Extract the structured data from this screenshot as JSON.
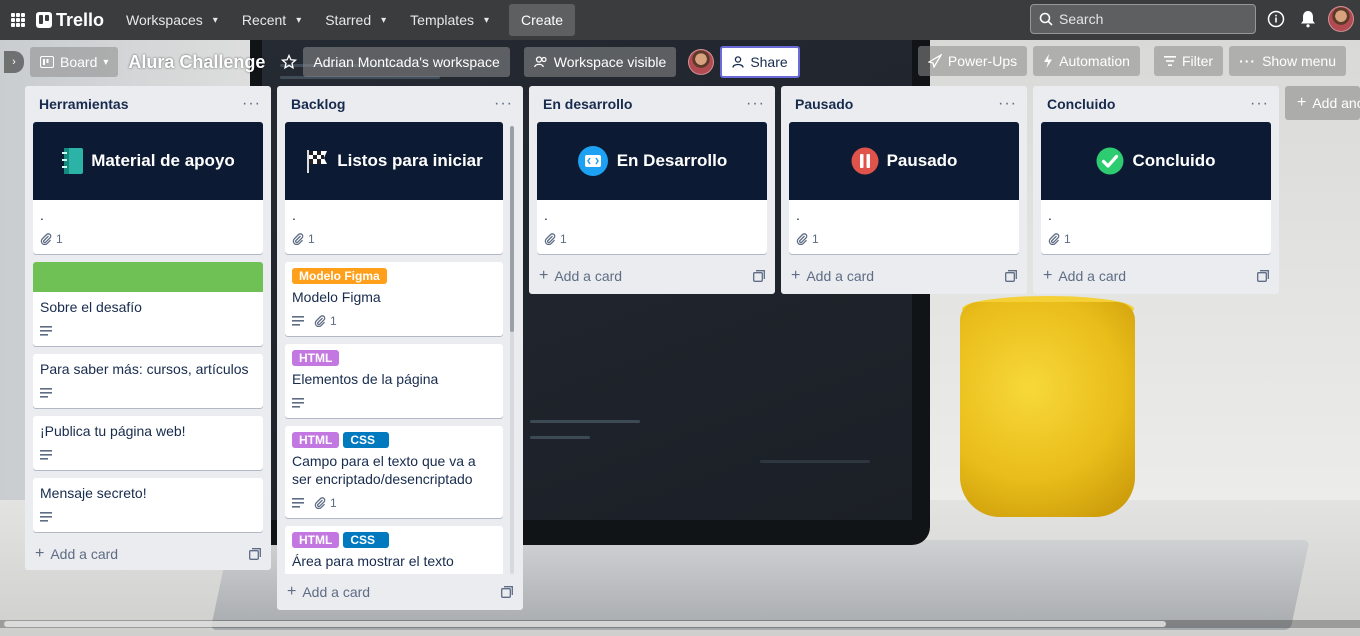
{
  "topbar": {
    "brand": "Trello",
    "menus": [
      "Workspaces",
      "Recent",
      "Starred",
      "Templates"
    ],
    "create_label": "Create",
    "search_placeholder": "Search"
  },
  "board": {
    "view_label": "Board",
    "title": "Alura Challenge",
    "workspace": "Adrian Montcada's workspace",
    "visibility": "Workspace visible",
    "share_label": "Share",
    "powerups_label": "Power-Ups",
    "automation_label": "Automation",
    "filter_label": "Filter",
    "show_menu_label": "Show menu",
    "add_list_label": "Add ano"
  },
  "colors": {
    "cover_dark": "#0c1a33",
    "label_orange": "#ff9f1a",
    "label_purple": "#c377e0",
    "label_blue": "#0079bf",
    "cover_green": "#70c155"
  },
  "add_card_label": "Add a card",
  "lists": [
    {
      "title": "Herramientas",
      "cards": [
        {
          "cover_text": "Material de apoyo",
          "cover_icon": "notebook-icon",
          "title": ".",
          "attachments": "1"
        },
        {
          "cover": "green",
          "title": "Sobre el desafío",
          "description": true
        },
        {
          "title": "Para saber más: cursos, artículos",
          "description": true
        },
        {
          "title": "¡Publica tu página web!",
          "description": true
        },
        {
          "title": "Mensaje secreto!",
          "description": true
        }
      ]
    },
    {
      "title": "Backlog",
      "cards": [
        {
          "cover_text": "Listos para iniciar",
          "cover_icon": "checkered-flag-icon",
          "title": ".",
          "attachments": "1"
        },
        {
          "labels": [
            {
              "text": "Modelo Figma",
              "color": "orange"
            }
          ],
          "title": "Modelo Figma",
          "description": true,
          "attachments": "1"
        },
        {
          "labels": [
            {
              "text": "HTML",
              "color": "purple"
            }
          ],
          "title": "Elementos de la página",
          "description": true
        },
        {
          "labels": [
            {
              "text": "HTML",
              "color": "purple"
            },
            {
              "text": "CSS",
              "color": "blue"
            }
          ],
          "title": "Campo para el texto que va a ser encriptado/desencriptado",
          "description": true,
          "attachments": "1"
        },
        {
          "labels": [
            {
              "text": "HTML",
              "color": "purple"
            },
            {
              "text": "CSS",
              "color": "blue"
            }
          ],
          "title": "Área para mostrar el texto encriptado/desencriptado."
        }
      ]
    },
    {
      "title": "En desarrollo",
      "cards": [
        {
          "cover_text": "En Desarrollo",
          "cover_icon": "code-icon",
          "title": ".",
          "attachments": "1"
        }
      ]
    },
    {
      "title": "Pausado",
      "cards": [
        {
          "cover_text": "Pausado",
          "cover_icon": "pause-icon",
          "title": ".",
          "attachments": "1"
        }
      ]
    },
    {
      "title": "Concluido",
      "cards": [
        {
          "cover_text": "Concluido",
          "cover_icon": "check-icon",
          "title": ".",
          "attachments": "1"
        }
      ]
    }
  ]
}
